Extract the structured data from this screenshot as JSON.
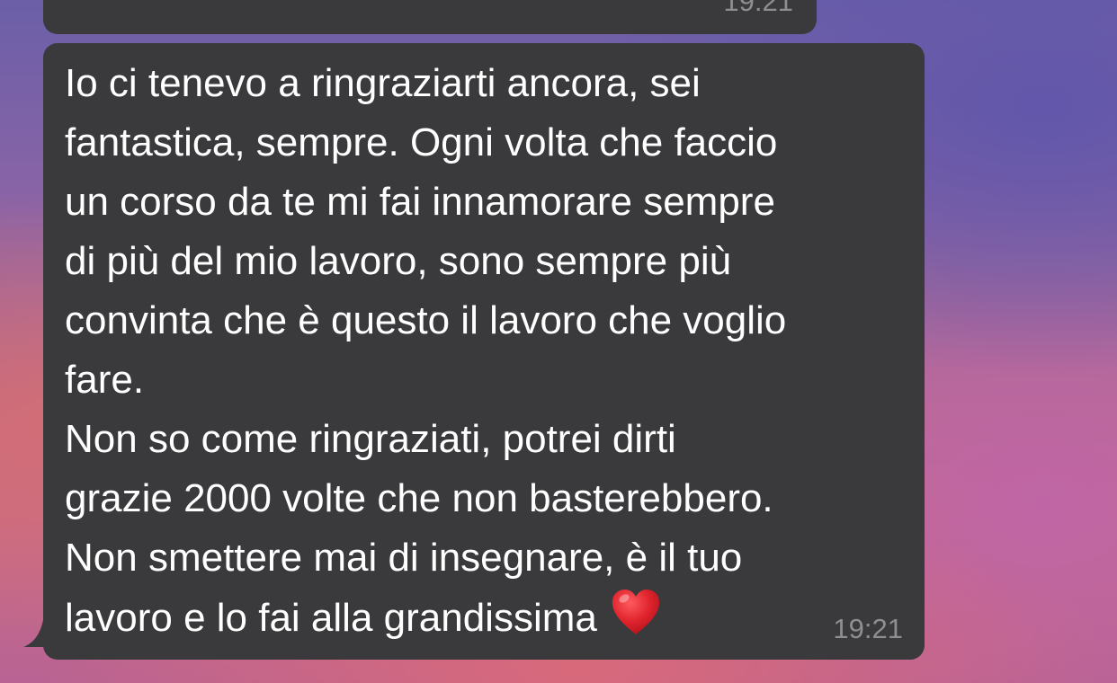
{
  "previous_message": {
    "time": "19:21"
  },
  "message": {
    "lines": [
      "Io ci tenevo a ringraziarti ancora, sei",
      "fantastica, sempre. Ogni volta che faccio",
      "un corso da te mi fai innamorare sempre",
      "di più del mio lavoro, sono sempre più",
      "convinta che è questo il lavoro che voglio",
      "fare.",
      "Non so come ringraziati, potrei dirti",
      "grazie 2000 volte che non basterebbero.",
      "Non smettere mai di insegnare, è il tuo",
      "lavoro e lo fai alla grandissima"
    ],
    "emoji": "heart-icon",
    "time": "19:21"
  },
  "colors": {
    "bubble": "#3a3a3c",
    "text": "#ffffff",
    "timestamp": "#8e8e93",
    "heart": "#e0242d"
  }
}
